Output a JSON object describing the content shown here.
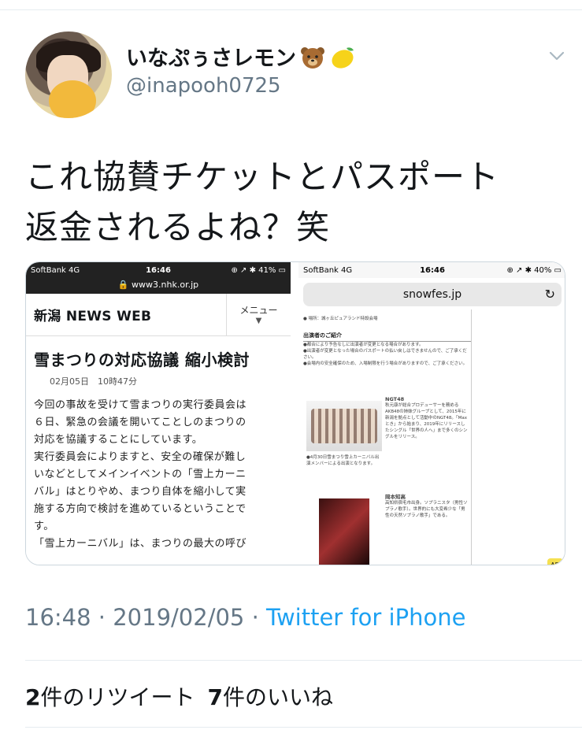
{
  "tweet": {
    "display_name": "いなぷぅさレモン",
    "name_emojis": [
      "bear-emoji",
      "lemon-emoji"
    ],
    "handle": "@inapooh0725",
    "text_line1": "これ協賛チケットとパスポート",
    "text_line2": "返金されるよね？笑",
    "time": "16:48 · 2019/02/05 · ",
    "source": "Twitter for iPhone",
    "retweet_count": "2",
    "retweet_label": "件のリツイート",
    "like_count": "7",
    "like_label": "件のいいね"
  },
  "left_screenshot": {
    "carrier": "SoftBank  4G",
    "time": "16:46",
    "battery": "⊕ ↗ ✱ 41% ▭",
    "url": "🔒 www3.nhk.or.jp",
    "brand": "新潟 NEWS WEB",
    "menu_label": "メニュー",
    "menu_arrow": "▼",
    "headline": "雪まつりの対応協議 縮小検討",
    "date": "02月05日　10時47分",
    "body": [
      "今回の事故を受けて雪まつりの実行委員会は",
      "６日、緊急の会議を開いてことしのまつりの",
      "対応を協議することにしています。",
      "実行委員会によりますと、安全の確保が難し",
      "いなどとしてメインイベントの「雪上カーニ",
      "バル」はとりやめ、まつり自体を縮小して実",
      "施する方向で検討を進めているということで",
      "す。",
      "「雪上カーニバル」は、まつりの最大の呼び"
    ]
  },
  "right_screenshot": {
    "carrier": "SoftBank  4G",
    "time": "16:46",
    "battery": "⊕ ↗ ✱ 40% ▭",
    "url": "snowfes.jp",
    "reload": "↻",
    "venue": "● 場所：城ヶ丘ピュアランド特設会場",
    "performers_heading": "出演者のご紹介",
    "notes": [
      "●都合により予告なしに出演者が変更となる場合があります。",
      "●出演者が変更となった場合のパスポートの払い戻しはできませんので、ご了承ください。",
      "●会場内の安全確保のため、入場制限を行う場合がありますので、ご了承ください。"
    ],
    "ngt_name": "NGT48",
    "ngt_text": "秋元康が総合プロデューサーを務めるAKB48の姉妹グループとして、2015年に新潟を拠点として活動中のNGT48。「Maxとき」から始まり、2019年にリリースしたシングル「世界の人へ」まで多くのシングルをリリース。",
    "photo_caption": "●4月30日雪まつり雪上カーニバル出演メンバーによる出演となります。",
    "okamoto_name": "岡本知高",
    "okamoto_text": "高知県宿毛市出身。ソプラニスタ（男性ソプラノ歌手）。世界的にも大変希少な「男性の天然ソプラノ歌手」である。",
    "sticker": "AD"
  }
}
